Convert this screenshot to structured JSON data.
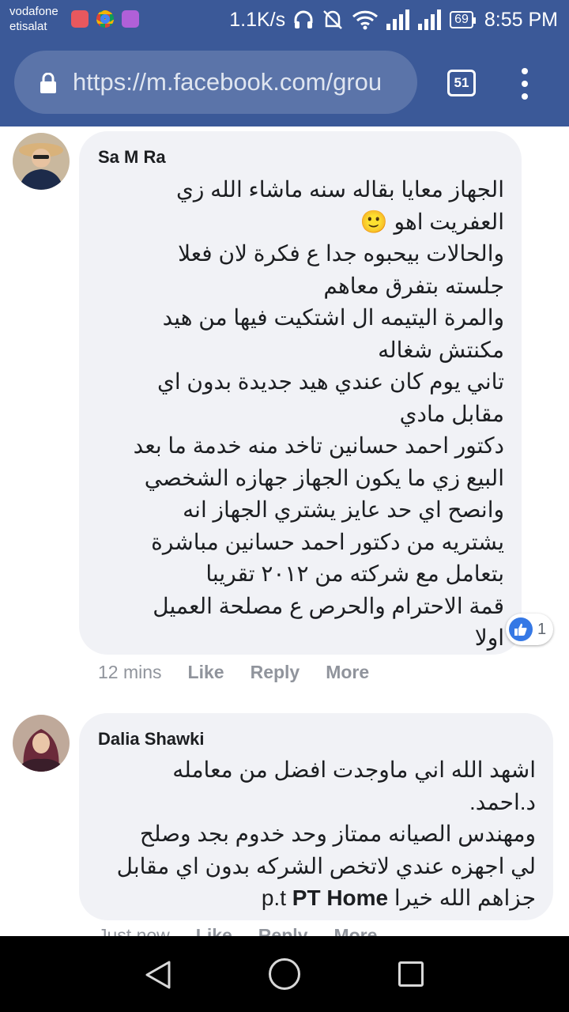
{
  "status_bar": {
    "carrier_line1": "vodafone",
    "carrier_line2": "etisalat",
    "net_speed": "1.1K/s",
    "battery": "69",
    "time": "8:55 PM"
  },
  "browser": {
    "url": "https://m.facebook.com/grou",
    "tab_count": "51"
  },
  "comments": [
    {
      "author": "Sa M Ra",
      "text": "الجهاز معايا بقاله سنه ماشاء الله زي\nالعفريت اهو 🙂\nوالحالات بيحبوه جدا ع فكرة لان فعلا\nجلسته بتفرق معاهم\nوالمرة اليتيمه ال اشتكيت فيها من هيد\nمكنتش شغاله\nتاني يوم كان عندي هيد جديدة بدون اي\nمقابل مادي\nدكتور احمد حسانين تاخد منه خدمة ما بعد\nالبيع زي ما يكون الجهاز جهازه الشخصي\nوانصح اي حد عايز يشتري الجهاز انه\nيشتريه من دكتور احمد حسانين مباشرة\nبتعامل مع شركته من ٢٠١٢ تقريبا\nقمة الاحترام والحرص ع مصلحة العميل\nاولا",
      "reaction_count": "1",
      "time": "12 mins",
      "like_label": "Like",
      "reply_label": "Reply",
      "more_label": "More"
    },
    {
      "author": "Dalia Shawki",
      "text": "اشهد الله اني ماوجدت افضل من معامله\nد.احمد.\nومهندس الصيانه ممتاز وحد خدوم بجد وصلح\nلي اجهزه عندي لاتخص الشركه بدون اي مقابل",
      "last_line_text": "جزاهم الله خيرا",
      "last_line_mention": "p.t",
      "last_line_brand": "PT Home",
      "time": "Just now",
      "like_label": "Like",
      "reply_label": "Reply",
      "more_label": "More"
    }
  ],
  "colors": {
    "facebook_blue": "#3b5998",
    "bubble_gray": "#f1f2f6",
    "like_blue": "#3578e5",
    "meta_gray": "#90949c"
  },
  "icons": [
    "lock-icon",
    "headphones-icon",
    "mute-icon",
    "wifi-icon",
    "signal-icon",
    "battery-icon",
    "like-reaction-icon",
    "back-icon",
    "home-icon",
    "recents-icon"
  ]
}
